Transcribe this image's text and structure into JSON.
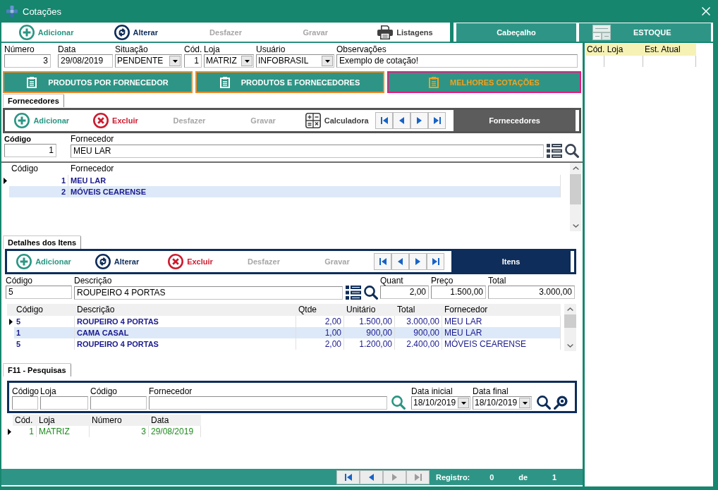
{
  "window": {
    "title": "Cotações"
  },
  "toolbar": {
    "buttons": [
      {
        "label": "Adicionar",
        "kind": "add",
        "disabled": false
      },
      {
        "label": "Alterar",
        "kind": "edit",
        "disabled": false
      },
      {
        "label": "Desfazer",
        "kind": "undo",
        "disabled": true
      },
      {
        "label": "Gravar",
        "kind": "save",
        "disabled": true
      },
      {
        "label": "Listagens",
        "kind": "print",
        "disabled": false
      }
    ]
  },
  "side_buttons": [
    {
      "label": "Cabeçalho",
      "kind": "plain"
    },
    {
      "label": "ESTOQUE",
      "kind": "stock"
    }
  ],
  "header_fields": [
    {
      "label": "Número",
      "value": "3",
      "kind": "number"
    },
    {
      "label": "Data",
      "value": "29/08/2019",
      "kind": "text"
    },
    {
      "label": "Situação",
      "value": "PENDENTE",
      "kind": "combo"
    },
    {
      "label": "Cód.",
      "value": "1",
      "kind": "number"
    },
    {
      "label": "Loja",
      "value": "MATRIZ",
      "kind": "combo"
    },
    {
      "label": "Usuário",
      "value": "INFOBRASIL",
      "kind": "combo"
    },
    {
      "label": "Observações",
      "value": "Exemplo de cotação!",
      "kind": "text"
    }
  ],
  "view_tabs": [
    {
      "label": "PRODUTOS POR FORNECEDOR",
      "selected": false
    },
    {
      "label": "PRODUTOS E FORNECEDORES",
      "selected": false
    },
    {
      "label": "MELHORES COTAÇÕES",
      "selected": true
    }
  ],
  "suppliers": {
    "tab": "Fornecedores",
    "toolbar": [
      {
        "label": "Adicionar",
        "kind": "add",
        "disabled": false
      },
      {
        "label": "Excluir",
        "kind": "delete",
        "disabled": false
      },
      {
        "label": "Desfazer",
        "kind": "undo",
        "disabled": true
      },
      {
        "label": "Gravar",
        "kind": "save",
        "disabled": true
      },
      {
        "label": "Calculadora",
        "kind": "calculator",
        "disabled": false
      }
    ],
    "navigator": [
      {
        "kind": "first",
        "disabled": false
      },
      {
        "kind": "prior",
        "disabled": false
      },
      {
        "kind": "next",
        "disabled": false
      },
      {
        "kind": "last",
        "disabled": false
      }
    ],
    "panel_title": "Fornecedores",
    "fields": [
      {
        "label": "Código",
        "value": "1",
        "kind": "number",
        "required": true
      },
      {
        "label": "Fornecedor",
        "value": "MEU LAR",
        "kind": "lookup",
        "required": false
      }
    ],
    "grid": {
      "columns": [
        {
          "label": "Código",
          "kind": "id"
        },
        {
          "label": "Fornecedor",
          "kind": "name"
        }
      ],
      "rows": [
        {
          "cells": [
            "1",
            "MEU LAR"
          ],
          "selected": true
        },
        {
          "cells": [
            "2",
            "MÓVEIS CEARENSE"
          ],
          "selected": false
        }
      ]
    }
  },
  "items": {
    "tab": "Detalhes dos Itens",
    "toolbar": [
      {
        "label": "Adicionar",
        "kind": "add",
        "disabled": false
      },
      {
        "label": "Alterar",
        "kind": "edit",
        "disabled": false
      },
      {
        "label": "Excluir",
        "kind": "delete",
        "disabled": false
      },
      {
        "label": "Desfazer",
        "kind": "undo",
        "disabled": true
      },
      {
        "label": "Gravar",
        "kind": "save",
        "disabled": true
      }
    ],
    "navigator": [
      {
        "kind": "first",
        "disabled": false
      },
      {
        "kind": "prior",
        "disabled": false
      },
      {
        "kind": "next",
        "disabled": false
      },
      {
        "kind": "last",
        "disabled": false
      }
    ],
    "panel_title": "Itens",
    "fields": [
      {
        "label": "Código",
        "value": "5",
        "kind": "text"
      },
      {
        "label": "Descrição",
        "value": "ROUPEIRO 4 PORTAS",
        "kind": "lookup"
      },
      {
        "label": "Quant",
        "value": "2,00",
        "kind": "number"
      },
      {
        "label": "Preço",
        "value": "1.500,00",
        "kind": "number"
      },
      {
        "label": "Total",
        "value": "3.000,00",
        "kind": "number"
      }
    ],
    "grid": {
      "columns": [
        {
          "label": "Código",
          "kind": "code"
        },
        {
          "label": "Descrição",
          "kind": "name"
        },
        {
          "label": "Qtde",
          "kind": "number"
        },
        {
          "label": "Unitário",
          "kind": "number"
        },
        {
          "label": "Total",
          "kind": "number"
        },
        {
          "label": "Fornecedor",
          "kind": "text"
        }
      ],
      "rows": [
        {
          "cells": [
            "5",
            "ROUPEIRO 4 PORTAS",
            "2,00",
            "1.500,00",
            "3.000,00",
            "MEU LAR"
          ],
          "selected": true
        },
        {
          "cells": [
            "1",
            "CAMA CASAL",
            "1,00",
            "900,00",
            "900,00",
            "MEU LAR"
          ],
          "selected": false
        },
        {
          "cells": [
            "5",
            "ROUPEIRO 4 PORTAS",
            "2,00",
            "1.200,00",
            "2.400,00",
            "MÓVEIS CEARENSE"
          ],
          "selected": false
        }
      ]
    }
  },
  "search": {
    "tab": "F11 - Pesquisas",
    "fields": [
      {
        "label": "Código",
        "kind": "text"
      },
      {
        "label": "Loja",
        "kind": "text"
      },
      {
        "label": "Código",
        "kind": "text"
      },
      {
        "label": "Fornecedor",
        "kind": "text"
      },
      {
        "label": "Data inicial",
        "value": "18/10/2019",
        "kind": "date"
      },
      {
        "label": "Data final",
        "value": "18/10/2019",
        "kind": "date"
      }
    ],
    "grid": {
      "columns": [
        {
          "label": "Cód.",
          "kind": "number"
        },
        {
          "label": "Loja",
          "kind": "text"
        },
        {
          "label": "Número",
          "kind": "number"
        },
        {
          "label": "Data",
          "kind": "text"
        }
      ],
      "rows": [
        {
          "cells": [
            "1",
            "MATRIZ",
            "3",
            "29/08/2019"
          ],
          "selected": true
        }
      ]
    }
  },
  "footer": {
    "navigator": [
      {
        "kind": "first",
        "disabled": false
      },
      {
        "kind": "prior",
        "disabled": false
      },
      {
        "kind": "next",
        "disabled": true
      },
      {
        "kind": "last",
        "disabled": true
      }
    ],
    "record_label": "Registro:",
    "record": "0",
    "of_label": "de",
    "total": "1"
  },
  "stock": {
    "columns": [
      "Cód. Loja",
      "Est. Atual"
    ]
  }
}
